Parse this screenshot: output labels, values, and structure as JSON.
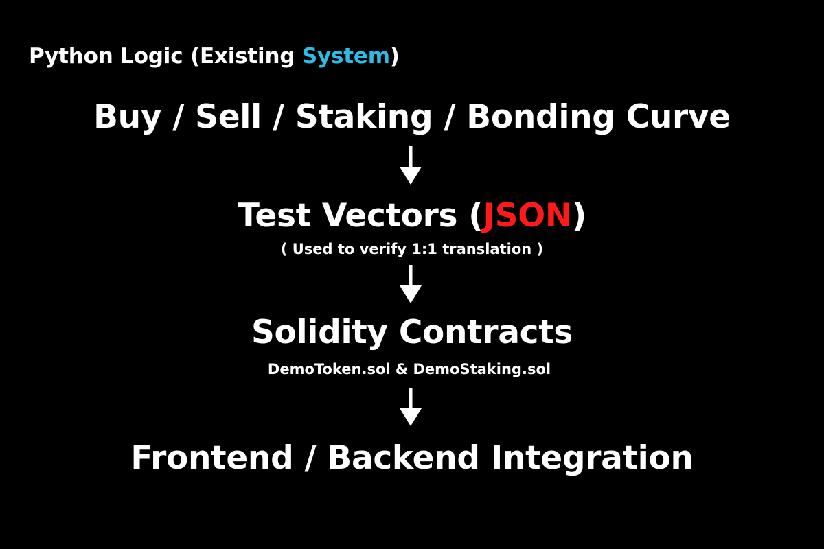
{
  "heading": {
    "prefix": "Python Logic (Existing ",
    "highlight": "System",
    "suffix": ")",
    "highlight_color": "#2bbde6"
  },
  "steps": [
    {
      "label": "Buy / Sell / Staking / Bonding Curve"
    },
    {
      "label_prefix": "Test Vectors (",
      "label_highlight": "JSON",
      "label_suffix": ")",
      "highlight_color": "#ff1a1a",
      "note": "( Used to verify 1:1 translation )"
    },
    {
      "label": "Solidity Contracts",
      "note": "DemoToken.sol & DemoStaking.sol"
    },
    {
      "label": "Frontend / Backend Integration"
    }
  ],
  "arrows": [
    {
      "icon": "arrow-down-icon"
    },
    {
      "icon": "arrow-down-icon"
    },
    {
      "icon": "arrow-down-icon"
    }
  ],
  "colors": {
    "background": "#000000",
    "text": "#ffffff"
  }
}
